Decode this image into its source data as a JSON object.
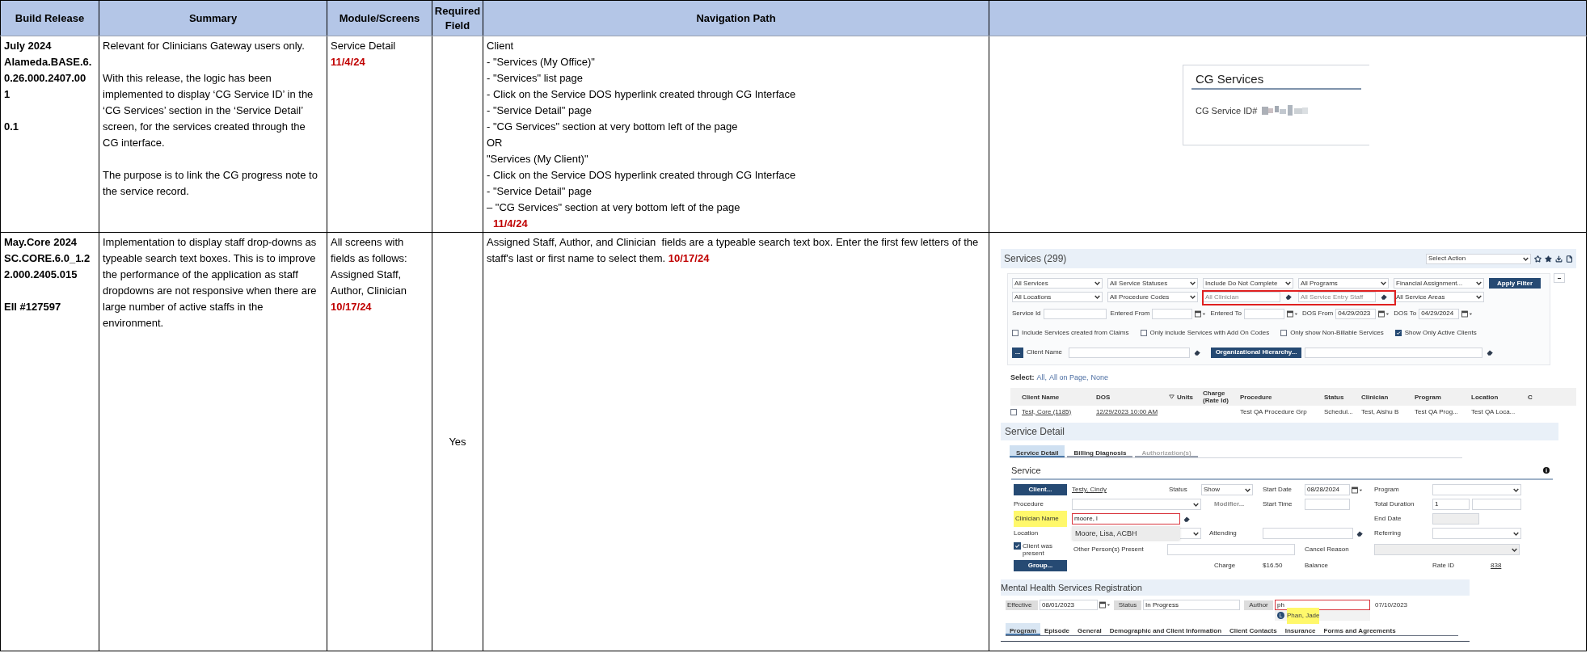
{
  "columns": [
    {
      "label": "Build Release"
    },
    {
      "label": "Summary"
    },
    {
      "label": "Module/Screens"
    },
    {
      "label": "Required Field"
    },
    {
      "label": "Navigation Path"
    }
  ],
  "rows": [
    {
      "build": [
        [
          "July 2024",
          "Alameda.BASE.6.",
          "0.26.000.2407.00",
          "1"
        ],
        [
          "0.1"
        ]
      ],
      "summary": [
        "Relevant for Clinicians Gateway users only.",
        "With this release, the logic has been implemented to display ‘CG Service ID’ in the ‘CG Services’ section in the ‘Service Detail’ screen, for the services created through the CG interface.",
        "The purpose is to link the CG progress note to the service record."
      ],
      "module": {
        "text": "Service Detail",
        "date": "11/4/24"
      },
      "navigation": {
        "kind": "steps",
        "lines": [
          "Client",
          "- \"Services (My Office)\"",
          "- \"Services\" list page",
          "- Click on the Service DOS hyperlink created through CG Interface",
          "- \"Service Detail\" page",
          "- \"CG Services\" section at very bottom left of the page",
          "OR",
          "\"Services (My Client)\"",
          "- Click on the Service DOS hyperlink created through CG Interface",
          "- \"Service Detail\" page",
          "– \"CG Services\" section at very bottom left of the page"
        ],
        "date": "11/4/24"
      },
      "screenshot": {
        "kind": "cg_services",
        "title": "CG Services",
        "label": "CG Service ID#"
      }
    },
    {
      "build": [
        [
          "May.Core 2024",
          "SC.CORE.6.0_1.2",
          "2.000.2405.015"
        ],
        [
          "EII #127597"
        ]
      ],
      "summary": [
        "Implementation to display staff drop-downs as typeable search text boxes. This is to improve the performance of the application as staff dropdowns are not responsive when there are large number of active staffs in the environment."
      ],
      "module": {
        "text": "All screens with fields as follows: Assigned Staff, Author, Clinician",
        "date": "10/17/24"
      },
      "required": "Yes",
      "navigation": {
        "kind": "paragraph",
        "lines": [
          "Assigned Staff, Author, and Clinician  fields are a typeable search text box. Enter the first few letters of the staff's last or first name to select them."
        ],
        "date": "10/17/24"
      },
      "screenshot": {
        "kind": "staff_search",
        "services": {
          "title": "Services (299)",
          "action": "Select Action",
          "filters": [
            [
              {
                "kind": "select",
                "text": "All Services"
              },
              {
                "kind": "select",
                "text": "All Service Statuses"
              },
              {
                "kind": "select",
                "text": "Include Do Not Complete"
              },
              {
                "kind": "select",
                "text": "All Programs"
              },
              {
                "kind": "select",
                "text": "Financial Assignment..."
              },
              {
                "kind": "button",
                "text": "Apply Filter"
              }
            ],
            [
              {
                "kind": "select",
                "text": "All Locations"
              },
              {
                "kind": "select",
                "text": "All Procedure Codes"
              },
              {
                "kind": "search",
                "placeholder": "All Clinician"
              },
              {
                "kind": "search",
                "placeholder": "All Service Entry Staff"
              },
              {
                "kind": "select",
                "text": "All Service Areas"
              }
            ]
          ],
          "date_filters": [
            {
              "kind": "text",
              "label": "Service Id"
            },
            {
              "kind": "date",
              "label": "Entered From"
            },
            {
              "kind": "date",
              "label": "Entered To"
            },
            {
              "kind": "date",
              "label": "DOS From",
              "value": "04/29/2023"
            },
            {
              "kind": "date",
              "label": "DOS To",
              "value": "04/29/2024"
            }
          ],
          "checkboxes": [
            {
              "label": "Include Services created from Claims",
              "checked": false
            },
            {
              "label": "Only include Services with Add On Codes",
              "checked": false
            },
            {
              "label": "Only show Non-Billable Services",
              "checked": false
            },
            {
              "label": "Show Only Active Clients",
              "checked": true
            }
          ],
          "more_button": "...",
          "client_name_label": "Client Name",
          "org_button": "Organizational Hierarchy...",
          "select_label": "Select:",
          "select_links": [
            "All,",
            "All on Page,",
            "None"
          ],
          "columns": [
            "Client Name",
            "DOS",
            "Units",
            "Charge (Rate Id)",
            "Procedure",
            "Status",
            "Clinician",
            "Program",
            "Location",
            "C"
          ],
          "row": {
            "checked": false,
            "client": "Test, Core (1185)",
            "dos": "12/29/2023 10:00 AM",
            "procedure": "Test QA Procedure Grp",
            "status": "Schedul...",
            "clinician": "Test, Aishu B",
            "program": "Test QA Prog...",
            "location": "Test QA Loca..."
          }
        },
        "service_detail": {
          "title": "Service Detail",
          "tabs": [
            {
              "label": "Service Detail",
              "selected": true,
              "disabled": false
            },
            {
              "label": "Billing Diagnosis",
              "selected": false,
              "disabled": false
            },
            {
              "label": "Authorization(s)",
              "selected": false,
              "disabled": true
            }
          ],
          "section": "Service",
          "client_button": "Client...",
          "client": "Testy, Cindy",
          "status_label": "Status",
          "status": "Show",
          "start_date_label": "Start Date",
          "start_date": "08/28/2024",
          "program_label": "Program",
          "procedure_label": "Procedure",
          "modifier": {
            "label": "Modifier...",
            "disabled": true
          },
          "start_time_label": "Start Time",
          "total_duration_label": "Total Duration",
          "total_duration": "1",
          "clinician_label": "Clinician Name",
          "clinician": "moore, l",
          "end_date_label": "End Date",
          "location_label": "Location",
          "suggestion": "Moore, Lisa, ACBH",
          "attending_label": "Attending",
          "referring_label": "Referring",
          "client_present": {
            "label": "Client was present",
            "checked": true
          },
          "other_persons_label": "Other Person(s) Present",
          "cancel_reason_label": "Cancel Reason",
          "group_button": "Group...",
          "charge_label": "Charge",
          "charge": "$16.50",
          "balance_label": "Balance",
          "rate_id_label": "Rate ID",
          "rate_id": "838"
        },
        "registration": {
          "title": "Mental Health Services Registration",
          "effective_label": "Effective",
          "effective": "08/01/2023",
          "status_label": "Status",
          "status": "In Progress",
          "author_label": "Author",
          "author": "ph",
          "next_date": "07/10/2023",
          "suggestion": {
            "badge": "L",
            "name": "Phan, Jade"
          },
          "tabs": [
            {
              "label": "Program",
              "selected": true
            },
            {
              "label": "Episode",
              "selected": false
            },
            {
              "label": "General",
              "selected": false
            },
            {
              "label": "Demographic and Client Information",
              "selected": false
            },
            {
              "label": "Client Contacts",
              "selected": false
            },
            {
              "label": "Insurance",
              "selected": false
            },
            {
              "label": "Forms and Agreements",
              "selected": false
            }
          ]
        }
      }
    }
  ]
}
